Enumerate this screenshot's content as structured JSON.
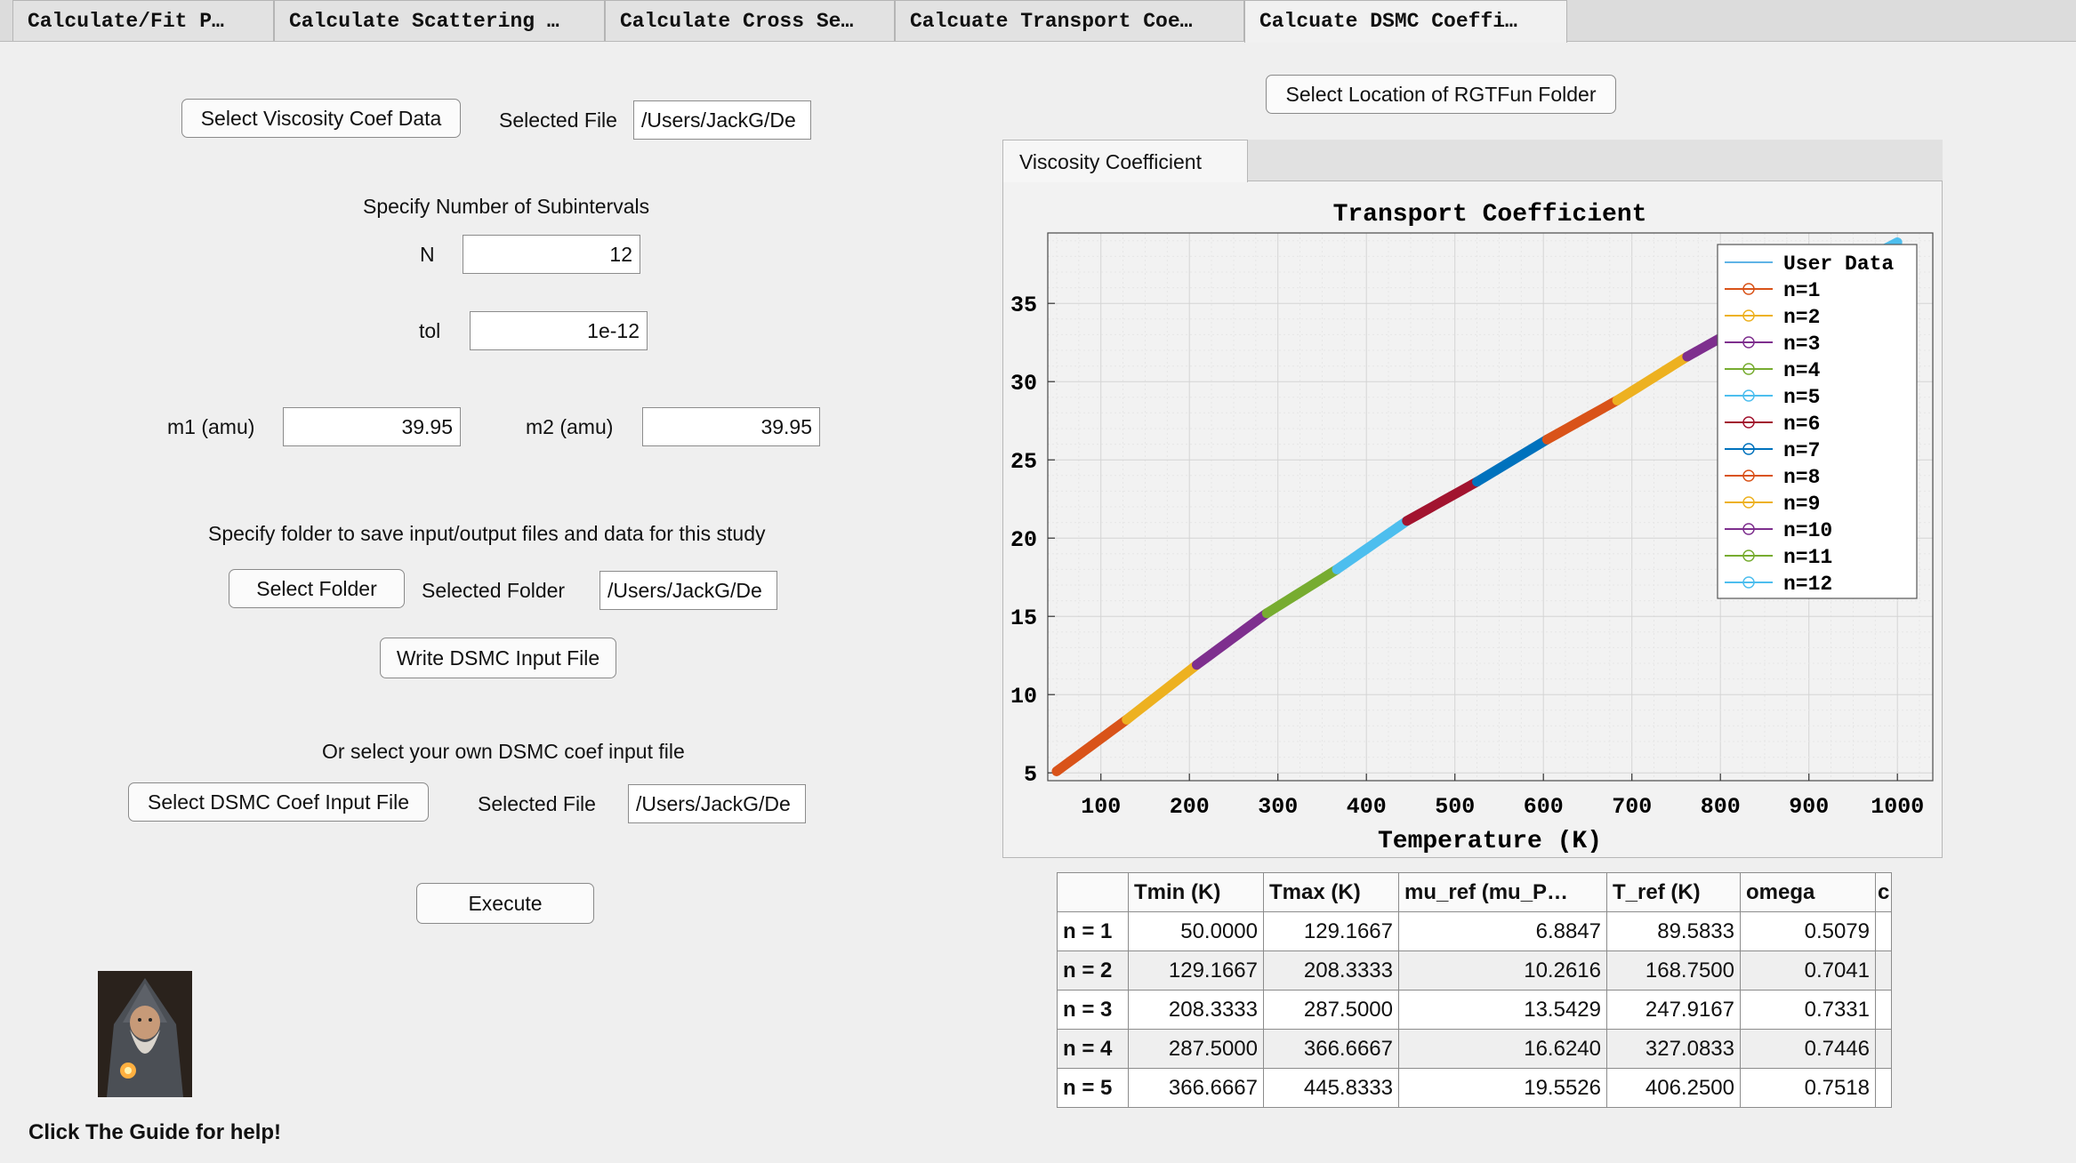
{
  "tabs": [
    {
      "label": "Calculate/Fit P…"
    },
    {
      "label": "Calculate Scattering …"
    },
    {
      "label": "Calculate Cross Se…"
    },
    {
      "label": "Calcuate Transport Coe…"
    },
    {
      "label": "Calcuate DSMC Coeffi…"
    }
  ],
  "left": {
    "select_visc_btn": "Select Viscosity Coef Data",
    "selected_file_label": "Selected File",
    "selected_file_value": "/Users/JackG/De",
    "subintervals_heading": "Specify Number of Subintervals",
    "n_label": "N",
    "n_value": "12",
    "tol_label": "tol",
    "tol_value": "1e-12",
    "m1_label": "m1 (amu)",
    "m1_value": "39.95",
    "m2_label": "m2 (amu)",
    "m2_value": "39.95",
    "folder_heading": "Specify folder to save input/output files and data for this study",
    "select_folder_btn": "Select Folder",
    "selected_folder_label": "Selected Folder",
    "selected_folder_value": "/Users/JackG/De",
    "write_btn": "Write DSMC Input File",
    "own_heading": "Or select your own DSMC coef input file",
    "select_dsmc_btn": "Select DSMC Coef Input File",
    "selected_file2_label": "Selected File",
    "selected_file2_value": "/Users/JackG/De",
    "execute_btn": "Execute",
    "help_text": "Click The Guide for help!"
  },
  "right": {
    "rgtfun_btn": "Select Location of RGTFun Folder",
    "plot_tab": "Viscosity Coefficient"
  },
  "chart_data": {
    "type": "line",
    "title": "Transport Coefficient",
    "xlabel": "Temperature (K)",
    "ylabel": "",
    "xlim": [
      40,
      1040
    ],
    "ylim": [
      4.5,
      39.5
    ],
    "xticks": [
      100,
      200,
      300,
      400,
      500,
      600,
      700,
      800,
      900,
      1000
    ],
    "yticks": [
      5,
      10,
      15,
      20,
      25,
      30,
      35
    ],
    "grid": true,
    "legend_position": "top-right",
    "legend": [
      "User Data",
      "n=1",
      "n=2",
      "n=3",
      "n=4",
      "n=5",
      "n=6",
      "n=7",
      "n=8",
      "n=9",
      "n=10",
      "n=11",
      "n=12"
    ],
    "user_data": {
      "name": "User Data",
      "color": "#5fb3e6",
      "x": [
        50,
        129.1667,
        208.3333,
        287.5,
        366.6667,
        445.8333,
        525,
        604.1667,
        683.3333,
        762.5,
        841.6667,
        920.8333,
        1000
      ],
      "y": [
        5.1,
        8.4,
        11.9,
        15.2,
        18.0,
        21.1,
        23.6,
        26.3,
        28.8,
        31.6,
        34.1,
        36.6,
        38.9
      ]
    },
    "series": [
      {
        "name": "n=1",
        "color": "#d95319",
        "xmin": 50,
        "xmax": 129.1667
      },
      {
        "name": "n=2",
        "color": "#edb120",
        "xmin": 129.1667,
        "xmax": 208.3333
      },
      {
        "name": "n=3",
        "color": "#7e2f8e",
        "xmin": 208.3333,
        "xmax": 287.5
      },
      {
        "name": "n=4",
        "color": "#77ac30",
        "xmin": 287.5,
        "xmax": 366.6667
      },
      {
        "name": "n=5",
        "color": "#4dbeee",
        "xmin": 366.6667,
        "xmax": 445.8333
      },
      {
        "name": "n=6",
        "color": "#a2142f",
        "xmin": 445.8333,
        "xmax": 525
      },
      {
        "name": "n=7",
        "color": "#0072bd",
        "xmin": 525,
        "xmax": 604.1667
      },
      {
        "name": "n=8",
        "color": "#d95319",
        "xmin": 604.1667,
        "xmax": 683.3333
      },
      {
        "name": "n=9",
        "color": "#edb120",
        "xmin": 683.3333,
        "xmax": 762.5
      },
      {
        "name": "n=10",
        "color": "#7e2f8e",
        "xmin": 762.5,
        "xmax": 841.6667
      },
      {
        "name": "n=11",
        "color": "#77ac30",
        "xmin": 841.6667,
        "xmax": 920.8333
      },
      {
        "name": "n=12",
        "color": "#4dbeee",
        "xmin": 920.8333,
        "xmax": 1000
      }
    ]
  },
  "table": {
    "headers": [
      "",
      "Tmin (K)",
      "Tmax (K)",
      "mu_ref (mu_P…",
      "T_ref (K)",
      "omega",
      "c"
    ],
    "rows": [
      [
        "n = 1",
        "50.0000",
        "129.1667",
        "6.8847",
        "89.5833",
        "0.5079"
      ],
      [
        "n = 2",
        "129.1667",
        "208.3333",
        "10.2616",
        "168.7500",
        "0.7041"
      ],
      [
        "n = 3",
        "208.3333",
        "287.5000",
        "13.5429",
        "247.9167",
        "0.7331"
      ],
      [
        "n = 4",
        "287.5000",
        "366.6667",
        "16.6240",
        "327.0833",
        "0.7446"
      ],
      [
        "n = 5",
        "366.6667",
        "445.8333",
        "19.5526",
        "406.2500",
        "0.7518"
      ]
    ]
  }
}
